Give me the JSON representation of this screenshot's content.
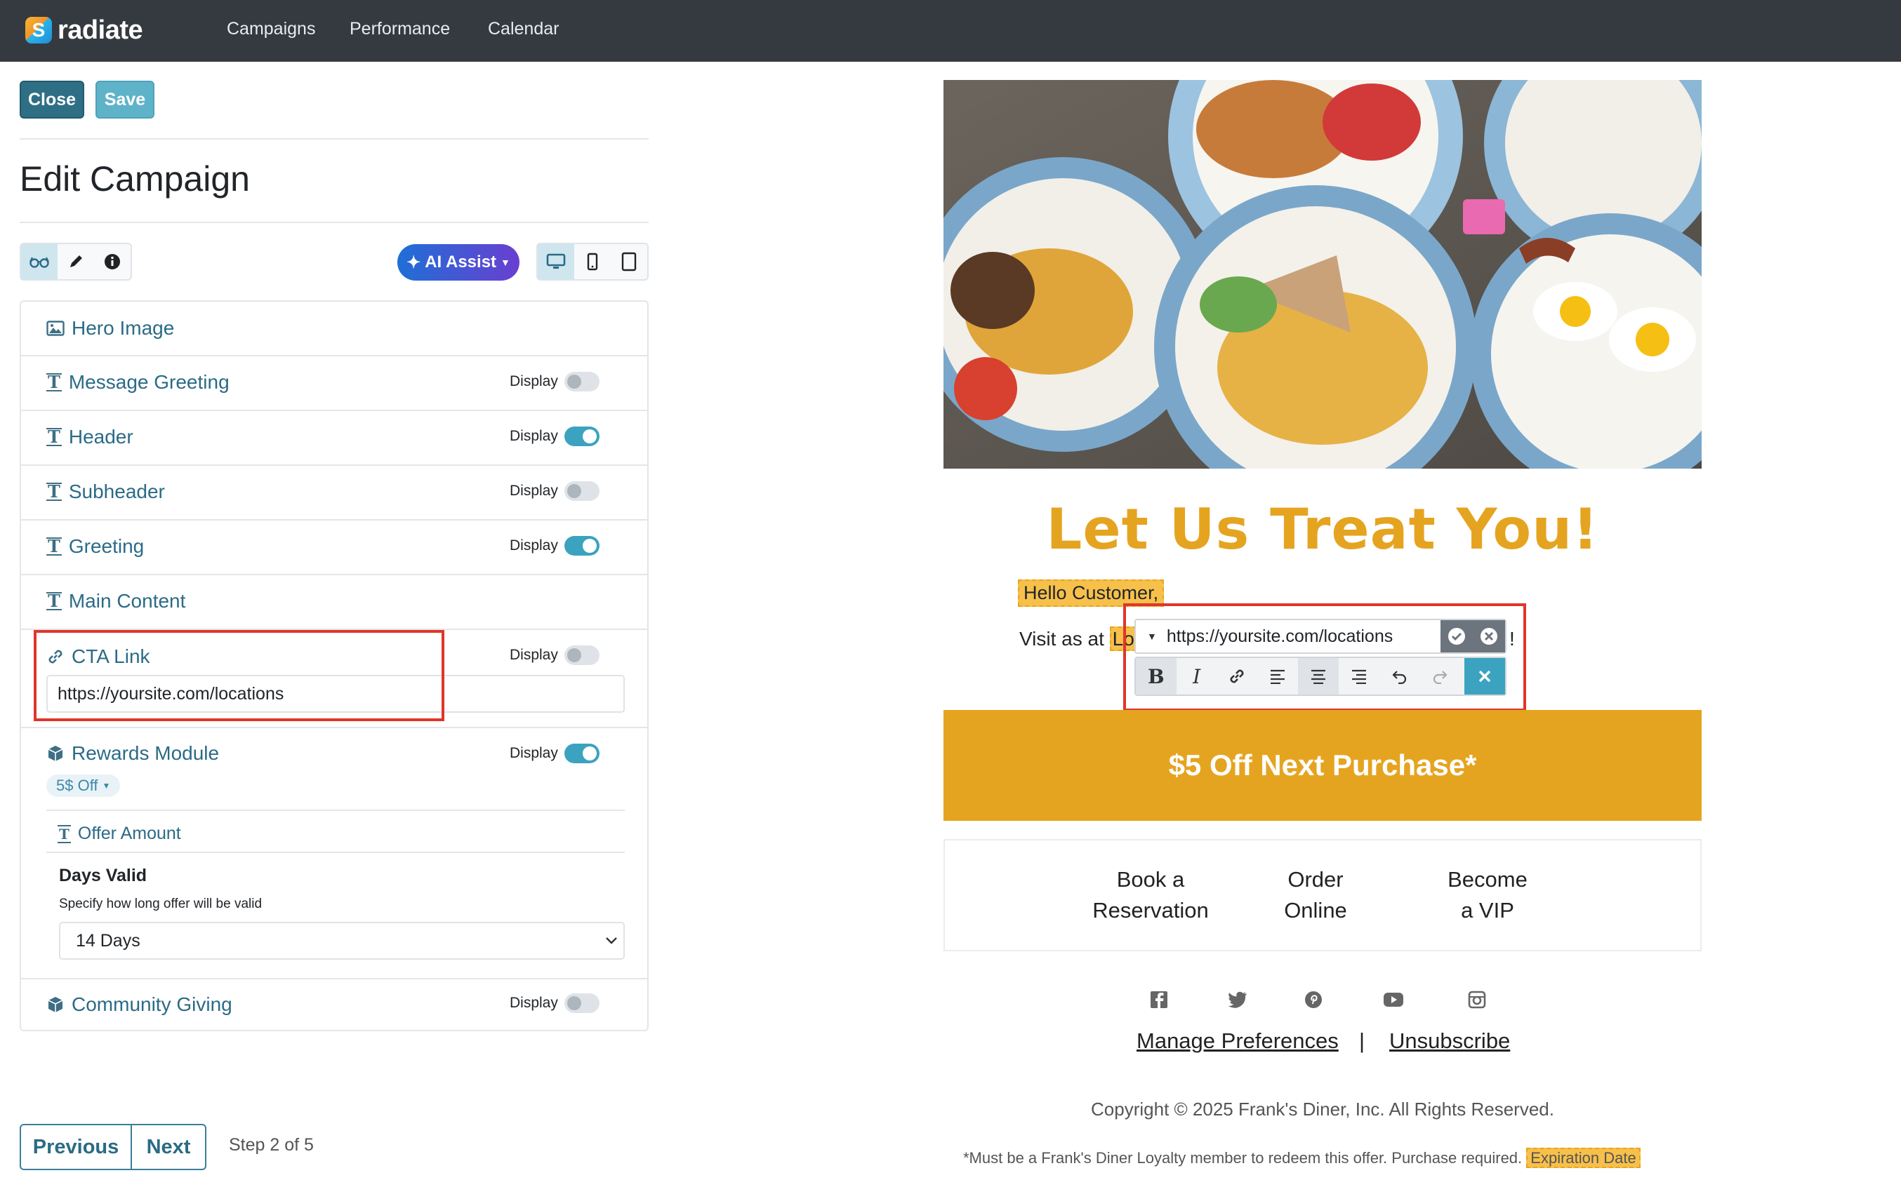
{
  "nav": {
    "brand": "radiate",
    "brand_icon": "S",
    "links": [
      "Campaigns",
      "Performance",
      "Calendar"
    ]
  },
  "actions": {
    "close": "Close",
    "save": "Save"
  },
  "page_title": "Edit Campaign",
  "toolbar": {
    "view_icons": [
      "glasses-icon",
      "pencil-icon",
      "info-icon"
    ],
    "ai_assist": "AI Assist",
    "device_icons": [
      "desktop-icon",
      "phone-icon",
      "tablet-icon"
    ]
  },
  "sections": {
    "display_label": "Display",
    "hero_image": "Hero Image",
    "message_greeting": {
      "label": "Message Greeting",
      "display": false
    },
    "header": {
      "label": "Header",
      "display": true
    },
    "subheader": {
      "label": "Subheader",
      "display": false
    },
    "greeting": {
      "label": "Greeting",
      "display": true
    },
    "main_content": "Main Content",
    "cta_link": {
      "label": "CTA Link",
      "display": false,
      "value": "https://yoursite.com/locations"
    },
    "rewards": {
      "label": "Rewards Module",
      "display": true,
      "pill": "5$ Off",
      "offer_amount": "Offer Amount",
      "days_valid_title": "Days Valid",
      "days_valid_help": "Specify how long offer will be valid",
      "days_valid_value": "14 Days"
    },
    "community": {
      "label": "Community Giving",
      "display": false
    }
  },
  "stepper": {
    "previous": "Previous",
    "next": "Next",
    "step_text": "Step 2 of 5"
  },
  "email": {
    "title": "Let Us Treat You!",
    "greeting": "Hello Customer,",
    "visit_prefix": "Visit as at",
    "visit_highlight": "Lo",
    "visit_suffix": "!",
    "editor_url": "https://yoursite.com/locations",
    "cta": "$5 Off Next Purchase*",
    "links": [
      {
        "line1": "Book a",
        "line2": "Reservation"
      },
      {
        "line1": "Order",
        "line2": "Online"
      },
      {
        "line1": "Become",
        "line2": "a VIP"
      }
    ],
    "social_icons": [
      "facebook-icon",
      "twitter-icon",
      "pinterest-icon",
      "youtube-icon",
      "instagram-icon"
    ],
    "manage_preferences": "Manage Preferences",
    "separator": "|",
    "unsubscribe": "Unsubscribe",
    "copyright": "Copyright © 2025 Frank's Diner, Inc. All Rights Reserved.",
    "disclaimer": "*Must be a Frank's Diner Loyalty member to redeem this offer. Purchase required.",
    "expiration": "Expiration Date"
  },
  "colors": {
    "nav_bg": "#343a40",
    "primary": "#2e6f86",
    "accent_gold": "#e5a420",
    "toggle_on": "#3ba3bf",
    "highlight_box": "#e0352b"
  }
}
